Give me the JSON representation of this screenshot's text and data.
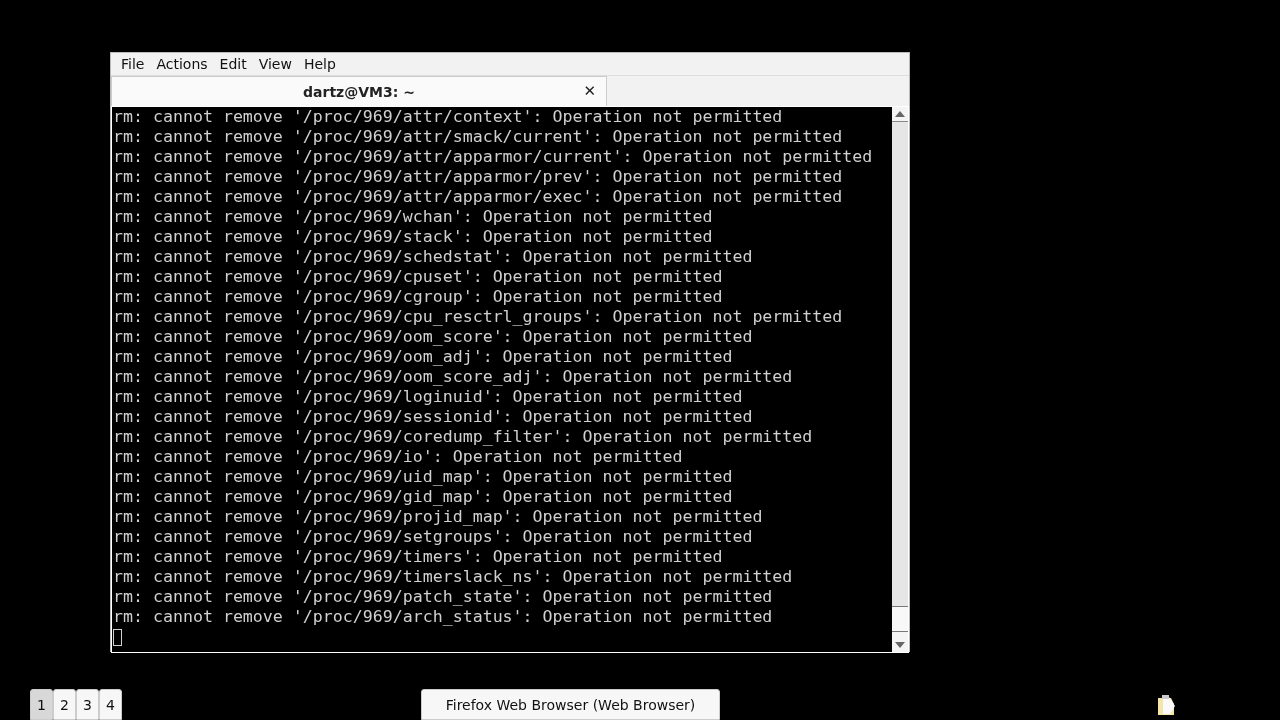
{
  "window": {
    "menu": [
      "File",
      "Actions",
      "Edit",
      "View",
      "Help"
    ],
    "tabs": [
      {
        "title": "dartz@VM3: ~",
        "close": "✕",
        "selected": true
      }
    ],
    "terminal": {
      "lines": [
        "rm: cannot remove '/proc/969/attr/context': Operation not permitted",
        "rm: cannot remove '/proc/969/attr/smack/current': Operation not permitted",
        "rm: cannot remove '/proc/969/attr/apparmor/current': Operation not permitted",
        "rm: cannot remove '/proc/969/attr/apparmor/prev': Operation not permitted",
        "rm: cannot remove '/proc/969/attr/apparmor/exec': Operation not permitted",
        "rm: cannot remove '/proc/969/wchan': Operation not permitted",
        "rm: cannot remove '/proc/969/stack': Operation not permitted",
        "rm: cannot remove '/proc/969/schedstat': Operation not permitted",
        "rm: cannot remove '/proc/969/cpuset': Operation not permitted",
        "rm: cannot remove '/proc/969/cgroup': Operation not permitted",
        "rm: cannot remove '/proc/969/cpu_resctrl_groups': Operation not permitted",
        "rm: cannot remove '/proc/969/oom_score': Operation not permitted",
        "rm: cannot remove '/proc/969/oom_adj': Operation not permitted",
        "rm: cannot remove '/proc/969/oom_score_adj': Operation not permitted",
        "rm: cannot remove '/proc/969/loginuid': Operation not permitted",
        "rm: cannot remove '/proc/969/sessionid': Operation not permitted",
        "rm: cannot remove '/proc/969/coredump_filter': Operation not permitted",
        "rm: cannot remove '/proc/969/io': Operation not permitted",
        "rm: cannot remove '/proc/969/uid_map': Operation not permitted",
        "rm: cannot remove '/proc/969/gid_map': Operation not permitted",
        "rm: cannot remove '/proc/969/projid_map': Operation not permitted",
        "rm: cannot remove '/proc/969/setgroups': Operation not permitted",
        "rm: cannot remove '/proc/969/timers': Operation not permitted",
        "rm: cannot remove '/proc/969/timerslack_ns': Operation not permitted",
        "rm: cannot remove '/proc/969/patch_state': Operation not permitted",
        "rm: cannot remove '/proc/969/arch_status': Operation not permitted"
      ]
    }
  },
  "taskbar": {
    "workspaces": [
      {
        "label": "1",
        "selected": true
      },
      {
        "label": "2",
        "selected": false
      },
      {
        "label": "3",
        "selected": false
      },
      {
        "label": "4",
        "selected": false
      }
    ],
    "tasks": [
      {
        "label": "Firefox Web Browser (Web Browser)",
        "selected": false
      }
    ]
  }
}
